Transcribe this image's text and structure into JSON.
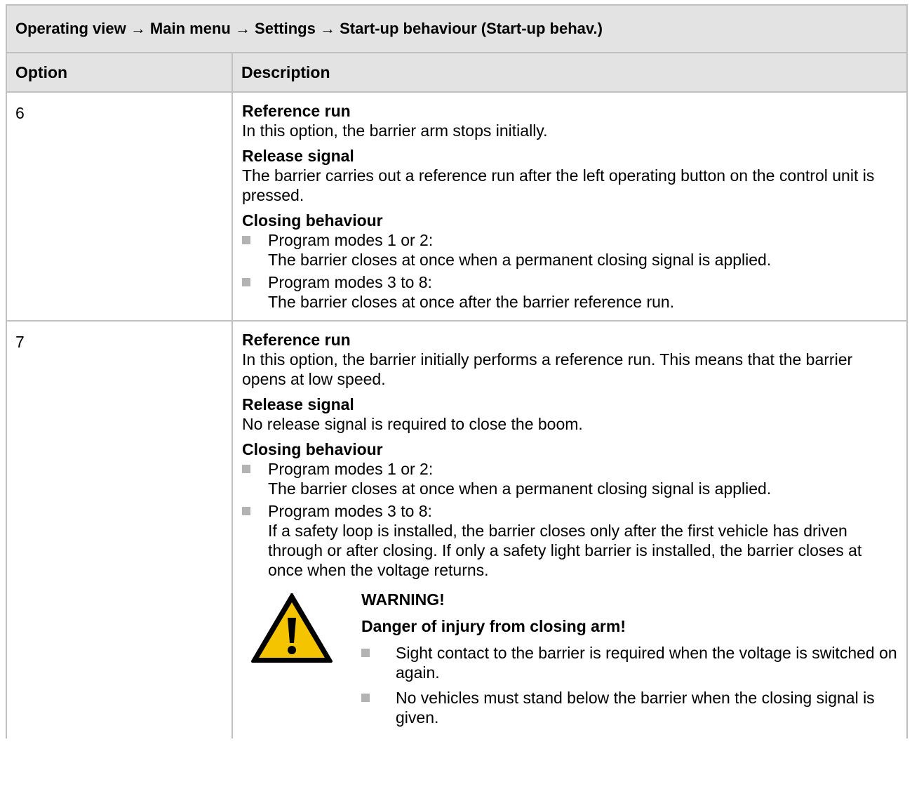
{
  "header": {
    "path": "Operating view → Main menu → Settings → Start-up behaviour (Start-up behav.)"
  },
  "columns": {
    "option": "Option",
    "description": "Description"
  },
  "rows": [
    {
      "option": "6",
      "reference_run": {
        "title": "Reference run",
        "text": "In this option, the barrier arm stops initially."
      },
      "release_signal": {
        "title": "Release signal",
        "text": "The barrier carries out a reference run after the left operating button on the control unit is pressed."
      },
      "closing": {
        "title": "Closing behaviour",
        "items": [
          {
            "mode": "Program modes 1 or 2:",
            "text": "The barrier closes at once when a permanent closing signal is applied."
          },
          {
            "mode": "Program modes 3 to 8:",
            "text": "The barrier closes at once after the barrier reference run."
          }
        ]
      }
    },
    {
      "option": "7",
      "reference_run": {
        "title": "Reference run",
        "text": "In this option, the barrier initially performs a reference run. This means that the barrier opens at low speed."
      },
      "release_signal": {
        "title": "Release signal",
        "text": "No release signal is required to close the boom."
      },
      "closing": {
        "title": "Closing behaviour",
        "items": [
          {
            "mode": "Program modes 1 or 2:",
            "text": "The barrier closes at once when a permanent closing signal is applied."
          },
          {
            "mode": "Program modes 3 to 8:",
            "text": "If a safety loop is installed, the barrier closes only after the first vehicle has driven through or after closing. If only a safety light barrier is installed, the barrier closes at once when the voltage returns."
          }
        ]
      },
      "warning": {
        "icon": "warning-triangle-icon",
        "title": "WARNING!",
        "subtitle": "Danger of injury from closing arm!",
        "items": [
          "Sight contact to the barrier is required when the voltage is switched on again.",
          "No vehicles must stand below the barrier when the closing signal is given."
        ]
      }
    }
  ],
  "colors": {
    "header_bg": "#e3e3e3",
    "border": "#c0c0c0",
    "bullet": "#b3b3b3",
    "warning_fill": "#f5c400"
  }
}
